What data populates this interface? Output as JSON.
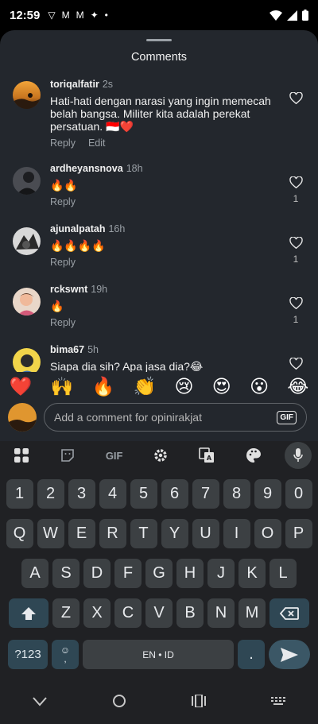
{
  "status_bar": {
    "time": "12:59"
  },
  "sheet": {
    "title": "Comments"
  },
  "comments": [
    {
      "user": "toriqalfatir",
      "time": "2s",
      "text": "Hati-hati dengan narasi yang ingin memecah belah bangsa. Militer kita adalah perekat persatuan. 🇮🇩❤️",
      "reply": "Reply",
      "edit": "Edit",
      "likes": ""
    },
    {
      "user": "ardheyansnova",
      "time": "18h",
      "text": "🔥🔥",
      "reply": "Reply",
      "likes": "1"
    },
    {
      "user": "ajunalpatah",
      "time": "16h",
      "text": "🔥🔥🔥🔥",
      "reply": "Reply",
      "likes": "1"
    },
    {
      "user": "rckswnt",
      "time": "19h",
      "text": "🔥",
      "reply": "Reply",
      "likes": "1"
    },
    {
      "user": "bima67",
      "time": "5h",
      "text": "Siapa dia sih? Apa jasa dia?😂",
      "reply": "",
      "likes": ""
    }
  ],
  "emoji_bar": [
    "❤️",
    "🙌",
    "🔥",
    "👏",
    "😢",
    "😍",
    "😮",
    "😂"
  ],
  "compose": {
    "placeholder": "Add a comment for opinirakjat",
    "gif": "GIF"
  },
  "keyboard": {
    "toolbar_gif": "GIF",
    "row_numbers": [
      "1",
      "2",
      "3",
      "4",
      "5",
      "6",
      "7",
      "8",
      "9",
      "0"
    ],
    "row_1": [
      "Q",
      "W",
      "E",
      "R",
      "T",
      "Y",
      "U",
      "I",
      "O",
      "P"
    ],
    "row_2": [
      "A",
      "S",
      "D",
      "F",
      "G",
      "H",
      "J",
      "K",
      "L"
    ],
    "row_3": [
      "Z",
      "X",
      "C",
      "V",
      "B",
      "N",
      "M"
    ],
    "symbols": "?123",
    "comma": ",",
    "space": "EN • ID",
    "period": "."
  },
  "colors": {
    "sheet_bg": "#23272d",
    "keyboard_bg": "#202124",
    "key_bg": "#3c4043",
    "accent_key": "#2f4754"
  }
}
